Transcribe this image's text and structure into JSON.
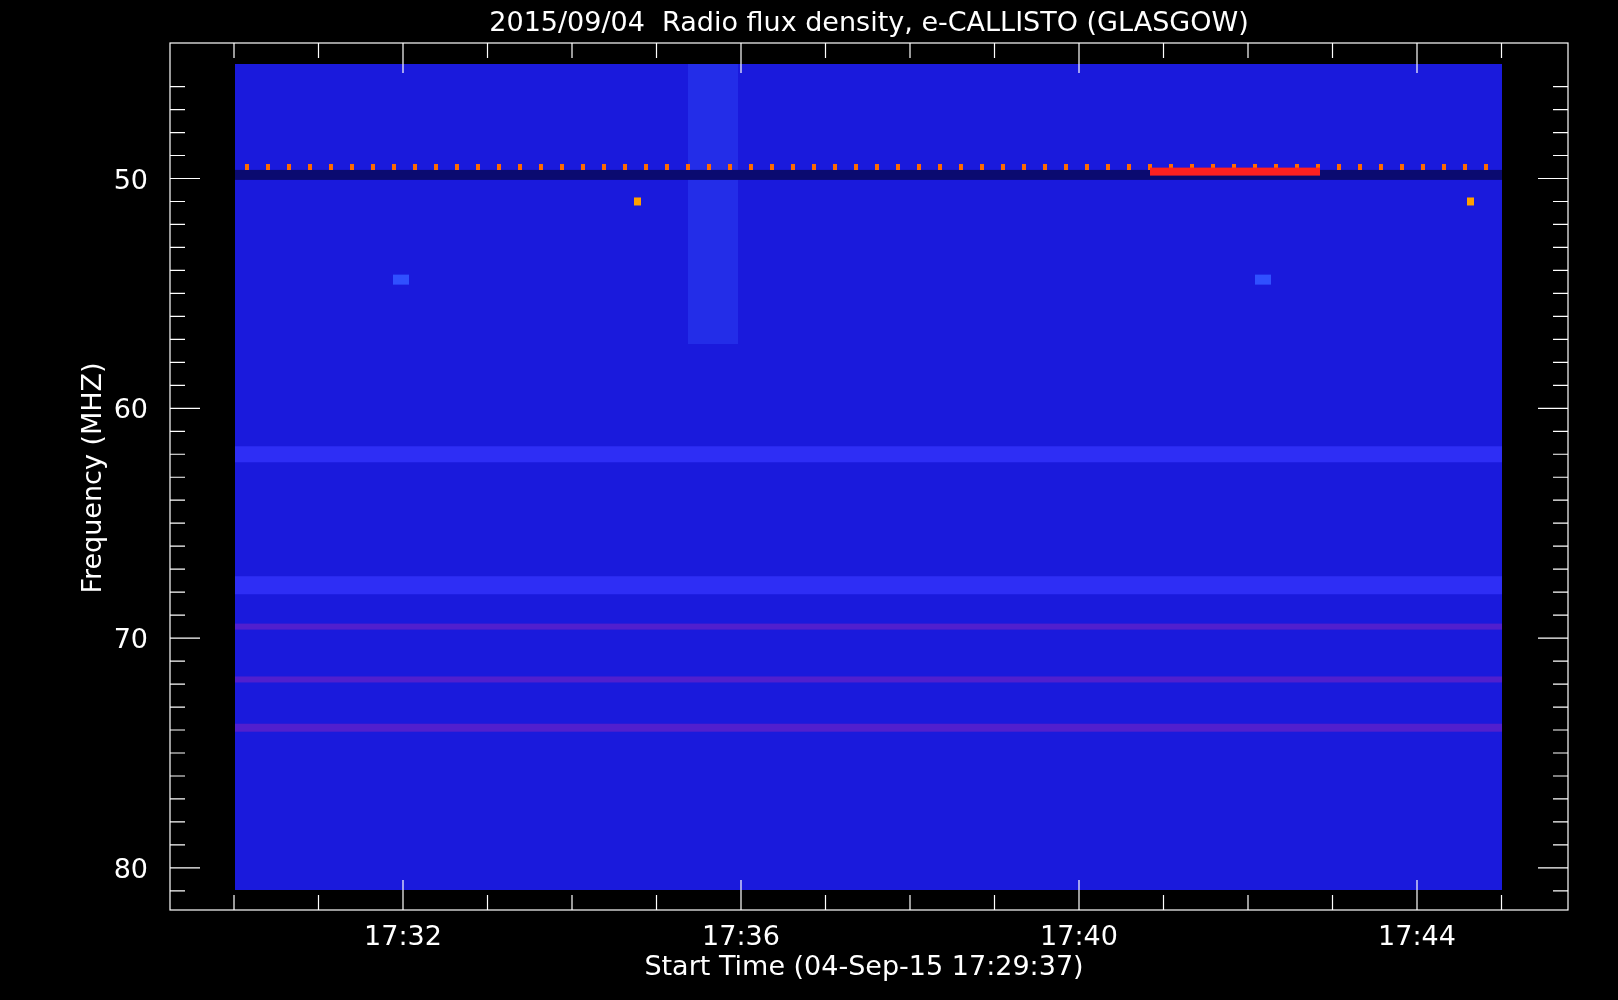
{
  "title": "2015/09/04  Radio flux density, e-CALLISTO (GLASGOW)",
  "y_axis": {
    "label": "Frequency (MHZ)",
    "ticks": [
      "50",
      "60",
      "70",
      "80"
    ]
  },
  "x_axis": {
    "label": "Start Time (04-Sep-15 17:29:37)",
    "ticks": [
      "17:32",
      "17:36",
      "17:40",
      "17:44"
    ]
  }
}
